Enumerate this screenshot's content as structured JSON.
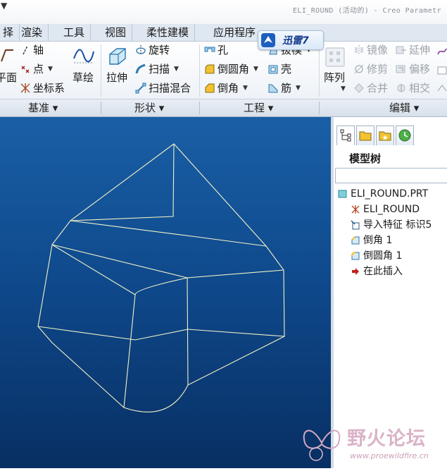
{
  "window": {
    "title": "ELI_ROUND (活动的) - Creo Parametr",
    "corner_arrow": "▼"
  },
  "menu": {
    "tabs": [
      "择",
      "渲染",
      "工具",
      "视图",
      "柔性建模",
      "应用程序"
    ]
  },
  "xunlei": {
    "label": "迅雷7"
  },
  "ribbon": {
    "datum": {
      "plane": "平面",
      "axis": "轴",
      "point": "点",
      "csys": "坐标系",
      "sketch": "草绘"
    },
    "shapes": {
      "extrude": "拉伸",
      "revolve": "旋转",
      "sweep": "扫描",
      "swept_blend": "扫描混合"
    },
    "engineering": {
      "hole": "孔",
      "round": "倒圆角",
      "chamfer": "倒角",
      "draft": "拔模",
      "shell": "壳",
      "rib": "筋"
    },
    "editing": {
      "pattern": "阵列",
      "mirror": "镜像",
      "trim": "修剪",
      "merge": "合并",
      "extend": "延伸",
      "offset": "偏移",
      "intersect": "相交"
    },
    "groups": [
      "基准",
      "形状",
      "工程",
      "编辑"
    ],
    "group_caret": "▾"
  },
  "model_tree": {
    "title": "模型树",
    "items": [
      {
        "label": "ELI_ROUND.PRT",
        "icon": "part-icon"
      },
      {
        "label": "ELI_ROUND",
        "icon": "csys-icon"
      },
      {
        "label": "导入特征 标识5",
        "icon": "import-feature-icon"
      },
      {
        "label": "倒角 1",
        "icon": "chamfer-icon"
      },
      {
        "label": "倒圆角 1",
        "icon": "round-icon"
      },
      {
        "label": "在此插入",
        "icon": "insert-arrow-icon"
      }
    ]
  },
  "watermark": {
    "text": "野火论坛",
    "url": "www.proewildfire.cn"
  },
  "colors": {
    "viewport_top": "#1a5fa6",
    "viewport_bottom": "#082f63",
    "wireframe": "#f2f2c8",
    "ribbon_bg": "#eef2f7",
    "menu_bg": "#dfe7f1"
  }
}
